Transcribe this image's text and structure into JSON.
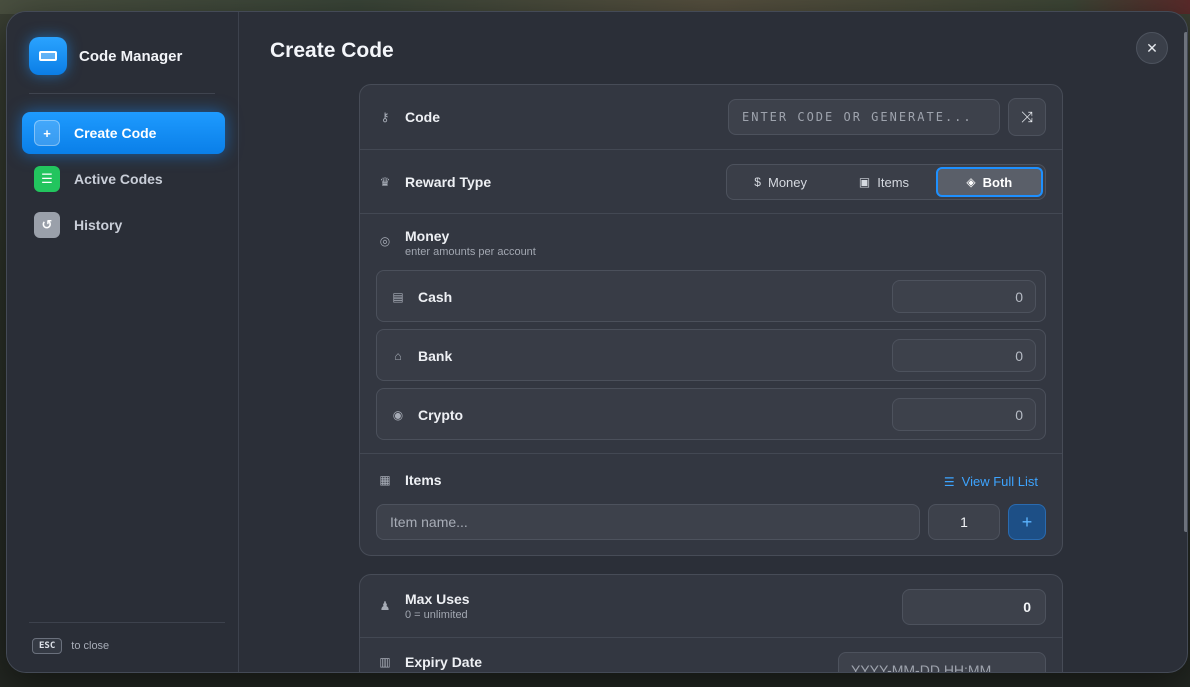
{
  "sidebar": {
    "title": "Code Manager",
    "items": [
      {
        "label": "Create Code",
        "active": true
      },
      {
        "label": "Active Codes",
        "active": false
      },
      {
        "label": "History",
        "active": false
      }
    ],
    "esc_key": "ESC",
    "esc_hint": "to close"
  },
  "main": {
    "title": "Create Code",
    "code": {
      "label": "Code",
      "placeholder": "ENTER CODE OR GENERATE..."
    },
    "reward_type": {
      "label": "Reward Type",
      "options": [
        {
          "label": "Money",
          "icon": "dollar-icon"
        },
        {
          "label": "Items",
          "icon": "box-icon"
        },
        {
          "label": "Both",
          "icon": "layers-icon"
        }
      ],
      "selected": "Both"
    },
    "money": {
      "label": "Money",
      "subtitle": "enter amounts per account",
      "accounts": [
        {
          "label": "Cash",
          "value": "0"
        },
        {
          "label": "Bank",
          "value": "0"
        },
        {
          "label": "Crypto",
          "value": "0"
        }
      ]
    },
    "items": {
      "label": "Items",
      "view_list": "View Full List",
      "name_placeholder": "Item name...",
      "quantity": "1",
      "add": "+"
    },
    "max_uses": {
      "label": "Max Uses",
      "subtitle": "0 = unlimited",
      "value": "0"
    },
    "expiry": {
      "label": "Expiry Date",
      "placeholder": "YYYY-MM-DD HH:MM"
    }
  },
  "colors": {
    "accent": "#1e90ff",
    "success": "#22c55e"
  }
}
